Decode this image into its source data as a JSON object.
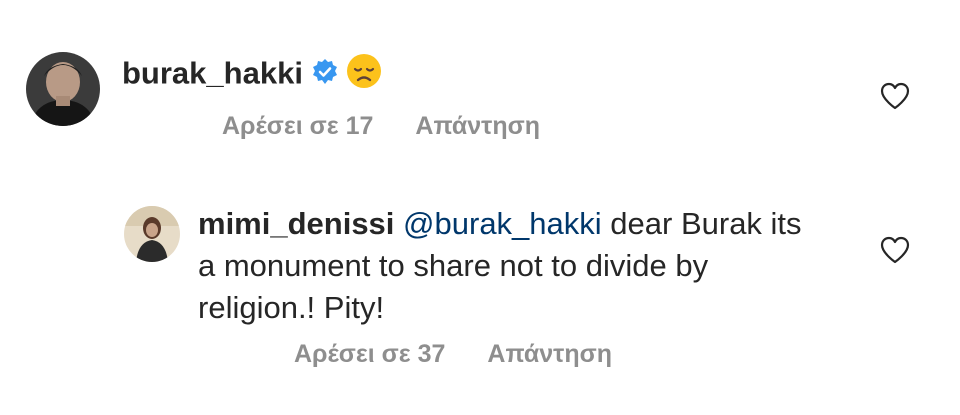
{
  "comments": [
    {
      "username": "burak_hakki",
      "verified": true,
      "emoji_icon": "disappointed-face-icon",
      "text": "",
      "likes_label": "Αρέσει σε 17",
      "reply_label": "Απάντηση"
    },
    {
      "username": "mimi_denissi",
      "verified": false,
      "mention": "@burak_hakki",
      "text_line1": "dear Burak its",
      "text_line2": "a monument to share not to divide by",
      "text_line3": "religion.! Pity!",
      "likes_label": "Αρέσει σε 37",
      "reply_label": "Απάντηση"
    }
  ],
  "colors": {
    "text": "#262626",
    "meta": "#8e8e8e",
    "mention": "#00376b",
    "verified": "#3897f0"
  },
  "icons": [
    "verified-badge-icon",
    "disappointed-face-icon",
    "heart-outline-icon",
    "avatar"
  ]
}
